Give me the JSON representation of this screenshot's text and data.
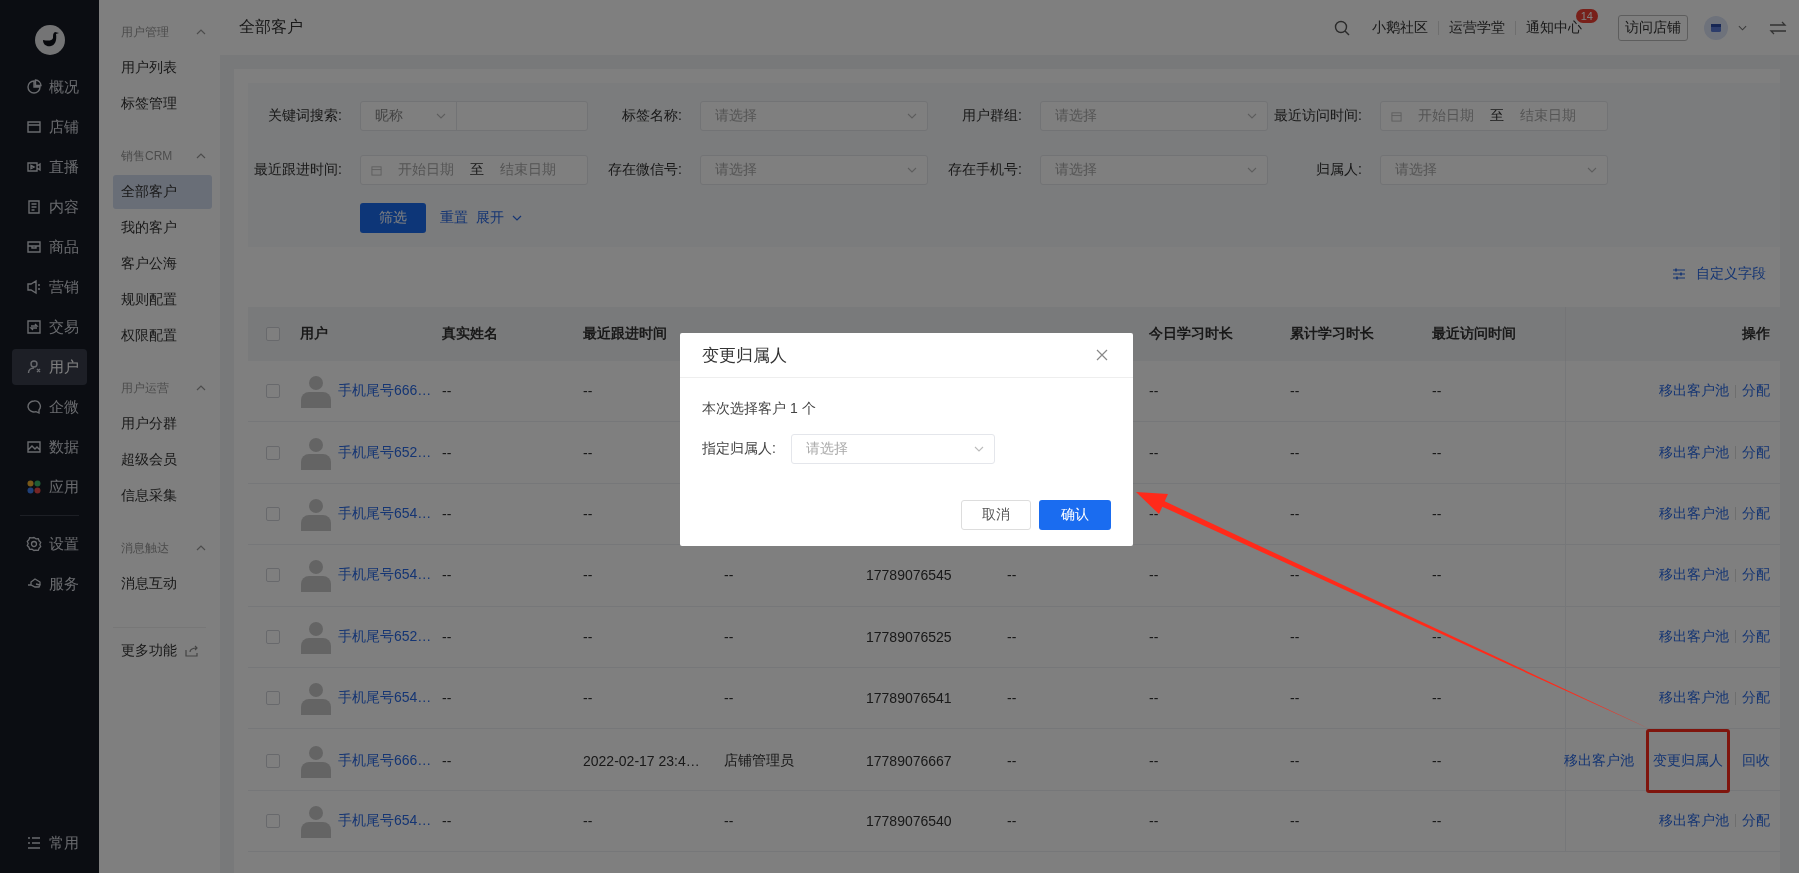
{
  "sidebar": {
    "items": [
      {
        "label": "概况",
        "selected": false
      },
      {
        "label": "店铺",
        "selected": false
      },
      {
        "label": "直播",
        "selected": false
      },
      {
        "label": "内容",
        "selected": false
      },
      {
        "label": "商品",
        "selected": false
      },
      {
        "label": "营销",
        "selected": false
      },
      {
        "label": "交易",
        "selected": false
      },
      {
        "label": "用户",
        "selected": true
      },
      {
        "label": "企微",
        "selected": false
      },
      {
        "label": "数据",
        "selected": false
      },
      {
        "label": "应用",
        "selected": false
      }
    ],
    "settings_items": [
      {
        "label": "设置",
        "selected": false
      },
      {
        "label": "服务",
        "selected": false
      }
    ],
    "footer_item": "常用"
  },
  "subnav": {
    "groups": [
      {
        "title": "用户管理",
        "expanded": true,
        "items": [
          {
            "label": "用户列表",
            "selected": false
          },
          {
            "label": "标签管理",
            "selected": false
          }
        ]
      },
      {
        "title": "销售CRM",
        "expanded": true,
        "items": [
          {
            "label": "全部客户",
            "selected": true
          },
          {
            "label": "我的客户",
            "selected": false
          },
          {
            "label": "客户公海",
            "selected": false
          },
          {
            "label": "规则配置",
            "selected": false
          },
          {
            "label": "权限配置",
            "selected": false
          }
        ]
      },
      {
        "title": "用户运营",
        "expanded": true,
        "items": [
          {
            "label": "用户分群",
            "selected": false
          },
          {
            "label": "超级会员",
            "selected": false
          },
          {
            "label": "信息采集",
            "selected": false
          }
        ]
      },
      {
        "title": "消息触达",
        "expanded": true,
        "items": [
          {
            "label": "消息互动",
            "selected": false
          }
        ]
      }
    ],
    "more": "更多功能"
  },
  "header": {
    "title": "全部客户",
    "links": [
      "小鹅社区",
      "运营学堂"
    ],
    "notifications": {
      "label": "通知中心",
      "badge": "14"
    },
    "visit_button": "访问店铺"
  },
  "filters": {
    "fields": [
      {
        "kind": "keyword",
        "label": "关键词搜索:",
        "select": "昵称"
      },
      {
        "kind": "select",
        "label": "标签名称:",
        "placeholder": "请选择"
      },
      {
        "kind": "select",
        "label": "用户群组:",
        "placeholder": "请选择"
      },
      {
        "kind": "daterange",
        "label": "最近访问时间:",
        "start": "开始日期",
        "separator": "至",
        "end": "结束日期"
      },
      {
        "kind": "daterange",
        "label": "最近跟进时间:",
        "start": "开始日期",
        "separator": "至",
        "end": "结束日期"
      },
      {
        "kind": "select",
        "label": "存在微信号:",
        "placeholder": "请选择"
      },
      {
        "kind": "select",
        "label": "存在手机号:",
        "placeholder": "请选择"
      },
      {
        "kind": "select",
        "label": "归属人:",
        "placeholder": "请选择"
      }
    ],
    "submit": "筛选",
    "reset": "重置",
    "expand": "展开"
  },
  "custom_fields": "自定义字段",
  "table": {
    "columns": [
      "用户",
      "真实姓名",
      "最近跟进时间"
    ],
    "columns_after_dialog": [
      "今日学习时长",
      "累计学习时长",
      "最近访问时间"
    ],
    "actions_column": "操作",
    "header_checked": false,
    "rows": [
      {
        "checked": false,
        "user": "手机尾号666…",
        "real_name": "--",
        "last_follow": "--",
        "today": "--",
        "total": "--",
        "last_visit": "--",
        "actions": [
          {
            "label": "移出客户池",
            "highlighted": false
          },
          {
            "label": "分配",
            "highlighted": false
          }
        ]
      },
      {
        "checked": false,
        "user": "手机尾号652…",
        "real_name": "--",
        "last_follow": "--",
        "today": "--",
        "total": "--",
        "last_visit": "--",
        "actions": [
          {
            "label": "移出客户池",
            "highlighted": false
          },
          {
            "label": "分配",
            "highlighted": false
          }
        ]
      },
      {
        "checked": false,
        "user": "手机尾号654…",
        "real_name": "--",
        "last_follow": "--",
        "today": "--",
        "total": "--",
        "last_visit": "--",
        "actions": [
          {
            "label": "移出客户池",
            "highlighted": false
          },
          {
            "label": "分配",
            "highlighted": false
          }
        ]
      },
      {
        "checked": false,
        "user": "手机尾号654…",
        "real_name": "--",
        "last_follow": "--",
        "owner": "--",
        "bound_phone": "17789076545",
        "collected_phone": "--",
        "today": "--",
        "total": "--",
        "last_visit": "--",
        "actions": [
          {
            "label": "移出客户池",
            "highlighted": false
          },
          {
            "label": "分配",
            "highlighted": false
          }
        ]
      },
      {
        "checked": false,
        "user": "手机尾号652…",
        "real_name": "--",
        "last_follow": "--",
        "owner": "--",
        "bound_phone": "17789076525",
        "collected_phone": "--",
        "today": "--",
        "total": "--",
        "last_visit": "--",
        "actions": [
          {
            "label": "移出客户池",
            "highlighted": false
          },
          {
            "label": "分配",
            "highlighted": false
          }
        ]
      },
      {
        "checked": false,
        "user": "手机尾号654…",
        "real_name": "--",
        "last_follow": "--",
        "owner": "--",
        "bound_phone": "17789076541",
        "collected_phone": "--",
        "today": "--",
        "total": "--",
        "last_visit": "--",
        "actions": [
          {
            "label": "移出客户池",
            "highlighted": false
          },
          {
            "label": "分配",
            "highlighted": false
          }
        ]
      },
      {
        "checked": false,
        "user": "手机尾号666…",
        "real_name": "--",
        "last_follow": "2022-02-17 23:4…",
        "owner": "店铺管理员",
        "bound_phone": "17789076667",
        "collected_phone": "--",
        "today": "--",
        "total": "--",
        "last_visit": "--",
        "actions": [
          {
            "label": "移出客户池",
            "highlighted": false
          },
          {
            "label": "变更归属人",
            "highlighted": true
          },
          {
            "label": "回收",
            "highlighted": false
          }
        ]
      },
      {
        "checked": false,
        "user": "手机尾号654…",
        "real_name": "--",
        "last_follow": "--",
        "owner": "--",
        "bound_phone": "17789076540",
        "collected_phone": "--",
        "today": "--",
        "total": "--",
        "last_visit": "--",
        "actions": [
          {
            "label": "移出客户池",
            "highlighted": false
          },
          {
            "label": "分配",
            "highlighted": false
          }
        ]
      }
    ]
  },
  "dialog": {
    "title": "变更归属人",
    "summary": "本次选择客户 1 个",
    "field_label": "指定归属人:",
    "placeholder": "请选择",
    "cancel": "取消",
    "confirm": "确认"
  }
}
